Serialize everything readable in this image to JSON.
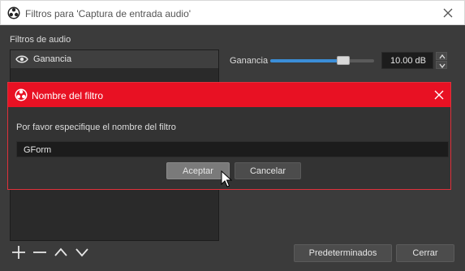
{
  "window": {
    "title": "Filtros para 'Captura de entrada audio'"
  },
  "filters": {
    "section_label": "Filtros de audio",
    "items": [
      {
        "label": "Ganancia",
        "visible": true
      }
    ]
  },
  "gain": {
    "label": "Ganancia",
    "value_text": "10.00 dB",
    "slider_fraction": 0.7
  },
  "dialog": {
    "title": "Nombre del filtro",
    "prompt": "Por favor especifique el nombre del filtro",
    "input_value": "GForm",
    "accept_label": "Aceptar",
    "cancel_label": "Cancelar"
  },
  "footer": {
    "defaults_label": "Predeterminados",
    "close_label": "Cerrar"
  },
  "icons": {
    "app": "obs-icon",
    "close": "close-icon",
    "eye": "eye-icon",
    "add": "plus-icon",
    "remove": "minus-icon",
    "up": "chevron-up-icon",
    "down": "chevron-down-icon"
  },
  "colors": {
    "accent": "#3b8ed8",
    "dialog_title": "#e81123"
  }
}
